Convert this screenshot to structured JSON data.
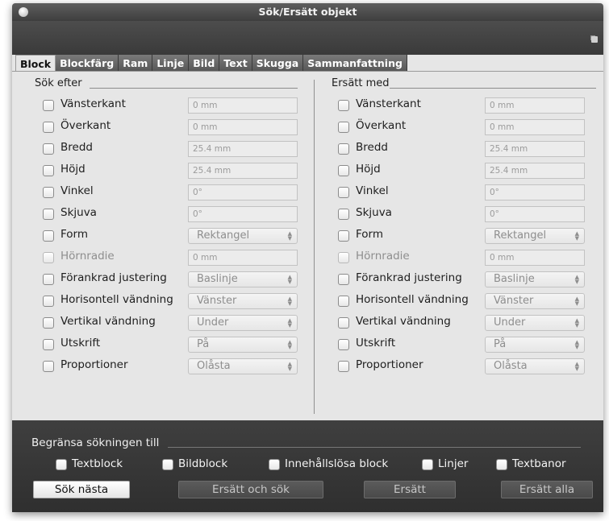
{
  "window": {
    "title": "Sök/Ersätt objekt"
  },
  "tabs": [
    "Block",
    "Blockfärg",
    "Ram",
    "Linje",
    "Bild",
    "Text",
    "Skugga",
    "Sammanfattning"
  ],
  "search": {
    "title": "Sök efter",
    "rows": [
      {
        "label": "Vänsterkant",
        "value": "0 mm"
      },
      {
        "label": "Överkant",
        "value": "0 mm"
      },
      {
        "label": "Bredd",
        "value": "25.4 mm"
      },
      {
        "label": "Höjd",
        "value": "25.4 mm"
      },
      {
        "label": "Vinkel",
        "value": "0°"
      },
      {
        "label": "Skjuva",
        "value": "0°"
      },
      {
        "label": "Form",
        "value": "Rektangel"
      },
      {
        "label": "Hörnradie",
        "value": "0 mm"
      },
      {
        "label": "Förankrad justering",
        "value": "Baslinje"
      },
      {
        "label": "Horisontell vändning",
        "value": "Vänster"
      },
      {
        "label": "Vertikal vändning",
        "value": "Under"
      },
      {
        "label": "Utskrift",
        "value": "På"
      },
      {
        "label": "Proportioner",
        "value": "Olåsta"
      }
    ]
  },
  "replace": {
    "title": "Ersätt med",
    "rows": [
      {
        "label": "Vänsterkant",
        "value": "0 mm"
      },
      {
        "label": "Överkant",
        "value": "0 mm"
      },
      {
        "label": "Bredd",
        "value": "25.4 mm"
      },
      {
        "label": "Höjd",
        "value": "25.4 mm"
      },
      {
        "label": "Vinkel",
        "value": "0°"
      },
      {
        "label": "Skjuva",
        "value": "0°"
      },
      {
        "label": "Form",
        "value": "Rektangel"
      },
      {
        "label": "Hörnradie",
        "value": "0 mm"
      },
      {
        "label": "Förankrad justering",
        "value": "Baslinje"
      },
      {
        "label": "Horisontell vändning",
        "value": "Vänster"
      },
      {
        "label": "Vertikal vändning",
        "value": "Under"
      },
      {
        "label": "Utskrift",
        "value": "På"
      },
      {
        "label": "Proportioner",
        "value": "Olåsta"
      }
    ]
  },
  "limit": {
    "title": "Begränsa sökningen till",
    "options": [
      "Textblock",
      "Bildblock",
      "Innehållslösa block",
      "Linjer",
      "Textbanor"
    ]
  },
  "buttons": {
    "find_next": "Sök nästa",
    "replace_and_find": "Ersätt och sök",
    "replace": "Ersätt",
    "replace_all": "Ersätt alla"
  }
}
